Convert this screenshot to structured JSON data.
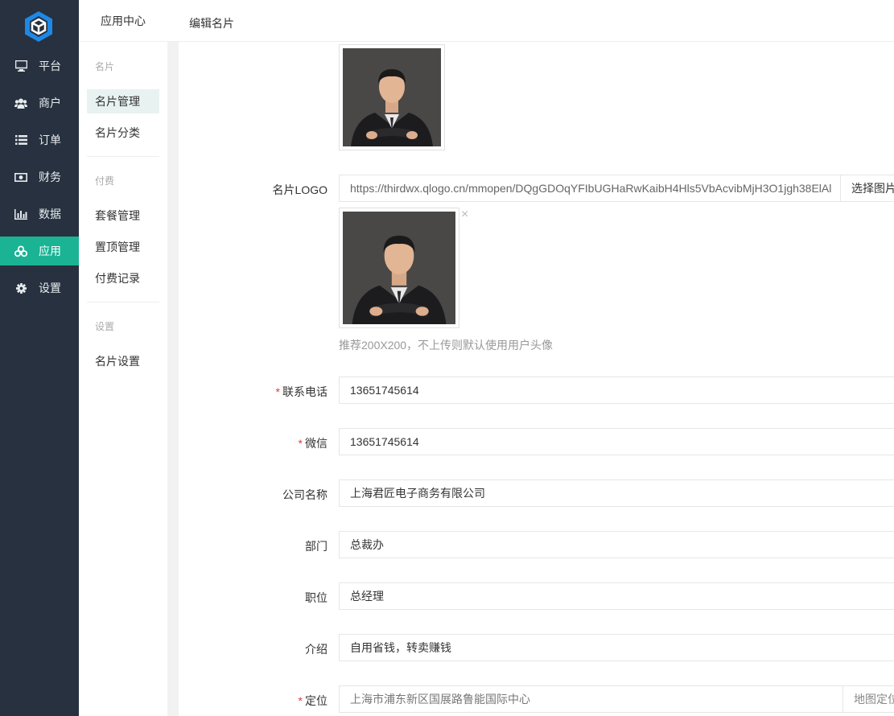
{
  "main_nav": {
    "items": [
      {
        "label": "平台",
        "icon": "monitor-icon"
      },
      {
        "label": "商户",
        "icon": "users-icon"
      },
      {
        "label": "订单",
        "icon": "list-icon"
      },
      {
        "label": "财务",
        "icon": "money-icon"
      },
      {
        "label": "数据",
        "icon": "bar-chart-icon"
      },
      {
        "label": "应用",
        "icon": "cubes-icon",
        "active": true
      },
      {
        "label": "设置",
        "icon": "gear-icon"
      }
    ],
    "active_color": "#1ab394",
    "bg_color": "#27313f"
  },
  "sub_nav": {
    "title": "应用中心",
    "groups": [
      {
        "name": "名片",
        "items": [
          "名片管理",
          "名片分类"
        ]
      },
      {
        "name": "付费",
        "items": [
          "套餐管理",
          "置顶管理",
          "付费记录"
        ]
      },
      {
        "name": "设置",
        "items": [
          "名片设置"
        ]
      }
    ]
  },
  "header": {
    "breadcrumb": "编辑名片"
  },
  "form": {
    "logo": {
      "label": "名片LOGO",
      "url_value": "https://thirdwx.qlogo.cn/mmopen/DQgGDOqYFIbUGHaRwKaibH4Hls5VbAcvibMjH3O1jgh38ElAl",
      "select_button": "选择图片",
      "remove_icon": "×",
      "help": "推荐200X200，不上传则默认使用用户头像"
    },
    "phone": {
      "label": "联系电话",
      "required": "*",
      "value": "13651745614"
    },
    "wechat": {
      "label": "微信",
      "required": "*",
      "value": "13651745614"
    },
    "company": {
      "label": "公司名称",
      "value": "上海君匠电子商务有限公司"
    },
    "department": {
      "label": "部门",
      "value": "总裁办"
    },
    "position": {
      "label": "职位",
      "value": "总经理"
    },
    "intro": {
      "label": "介绍",
      "value": "自用省钱，转卖赚钱"
    },
    "location": {
      "label": "定位",
      "required": "*",
      "value": "上海市浦东新区国展路鲁能国际中心",
      "map_button": "地图定位"
    }
  }
}
